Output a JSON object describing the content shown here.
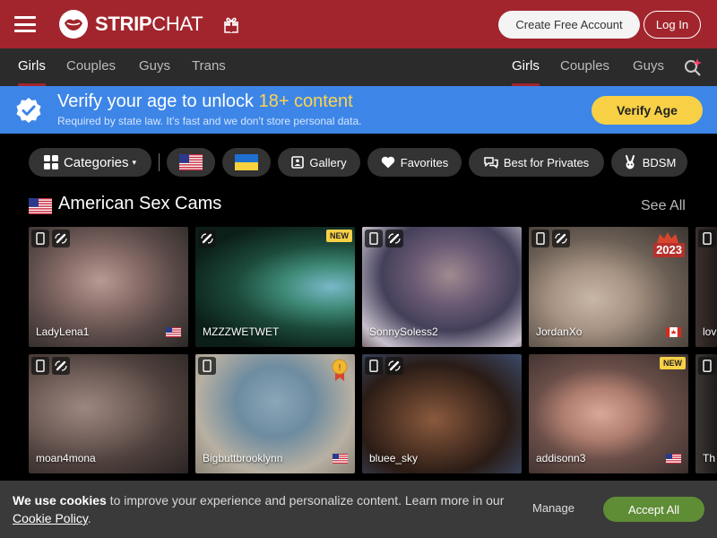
{
  "header": {
    "logo_strong": "STRIP",
    "logo_light": "CHAT",
    "create_account": "Create Free Account",
    "login": "Log In"
  },
  "nav_left": [
    "Girls",
    "Couples",
    "Guys",
    "Trans"
  ],
  "nav_right": [
    "Girls",
    "Couples",
    "Guys"
  ],
  "verify": {
    "title_prefix": "Verify your age to unlock ",
    "title_highlight": "18+ content",
    "subtitle": "Required by state law. It's fast and we don't store personal data.",
    "button": "Verify Age"
  },
  "filters": {
    "categories": "Categories",
    "gallery": "Gallery",
    "favorites": "Favorites",
    "best_for_privates": "Best for Privates",
    "bdsm": "BDSM"
  },
  "section": {
    "title": "American Sex Cams",
    "see_all": "See All"
  },
  "cards": [
    {
      "name": "LadyLena1",
      "flag": "us"
    },
    {
      "name": "MZZZWETWET",
      "tag": "NEW"
    },
    {
      "name": "SonnySoless2"
    },
    {
      "name": "JordanXo",
      "flag": "ca",
      "tag": "2023"
    },
    {
      "name": "lov"
    },
    {
      "name": "moan4mona"
    },
    {
      "name": "Bigbuttbrooklynn",
      "flag": "us"
    },
    {
      "name": "bluee_sky"
    },
    {
      "name": "addisonn3",
      "flag": "us",
      "tag": "NEW"
    },
    {
      "name": "Th"
    }
  ],
  "cookie": {
    "bold": "We use cookies",
    "text": " to improve your experience and personalize content. Learn more in our ",
    "link": "Cookie Policy",
    "end": ".",
    "manage": "Manage",
    "accept": "Accept All"
  },
  "colors": {
    "brand_red": "#a2252d",
    "verify_blue": "#3d86e8",
    "accent_yellow": "#f7d046",
    "accept_green": "#5f8d36"
  }
}
